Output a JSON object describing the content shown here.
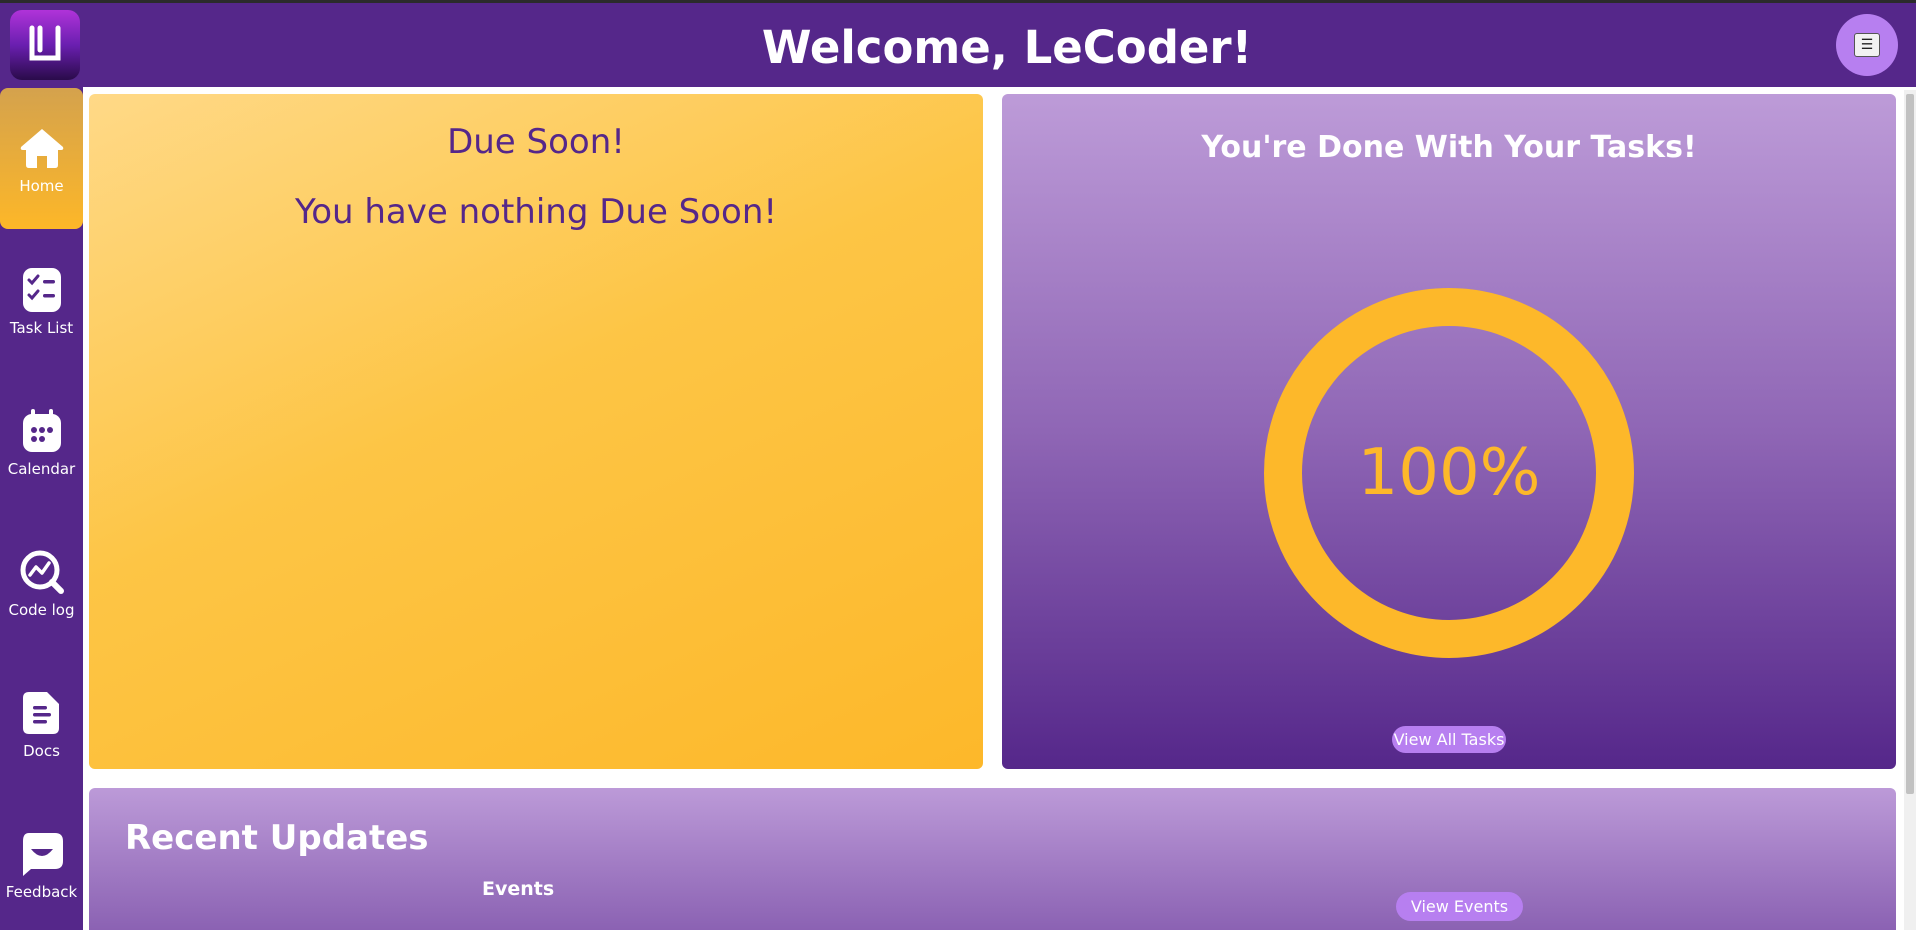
{
  "header": {
    "title": "Welcome, LeCoder!",
    "logo_icon": "lecoder-logo-icon",
    "menu_icon": "menu-icon",
    "menu_glyph": "☰",
    "color": "#55278a"
  },
  "sidebar": {
    "items": [
      {
        "label": "Home",
        "icon": "home-icon",
        "active": true
      },
      {
        "label": "Task List",
        "icon": "task-list-icon",
        "active": false
      },
      {
        "label": "Calendar",
        "icon": "calendar-icon",
        "active": false
      },
      {
        "label": "Code log",
        "icon": "code-log-icon",
        "active": false
      },
      {
        "label": "Docs",
        "icon": "docs-icon",
        "active": false
      },
      {
        "label": "Feedback",
        "icon": "feedback-icon",
        "active": false
      }
    ]
  },
  "due_soon": {
    "title": "Due Soon!",
    "message": "You have nothing Due Soon!"
  },
  "tasks": {
    "title": "You're Done With Your Tasks!",
    "progress_percent": 100,
    "progress_label": "100%",
    "button_label": "View All Tasks",
    "accent": "#fdb82a"
  },
  "recent_updates": {
    "title": "Recent Updates",
    "events_label": "Events",
    "view_events_label": "View Events"
  },
  "colors": {
    "brand_purple": "#55278a",
    "brand_yellow": "#fdb82a",
    "button_purple": "#b77ff0"
  }
}
